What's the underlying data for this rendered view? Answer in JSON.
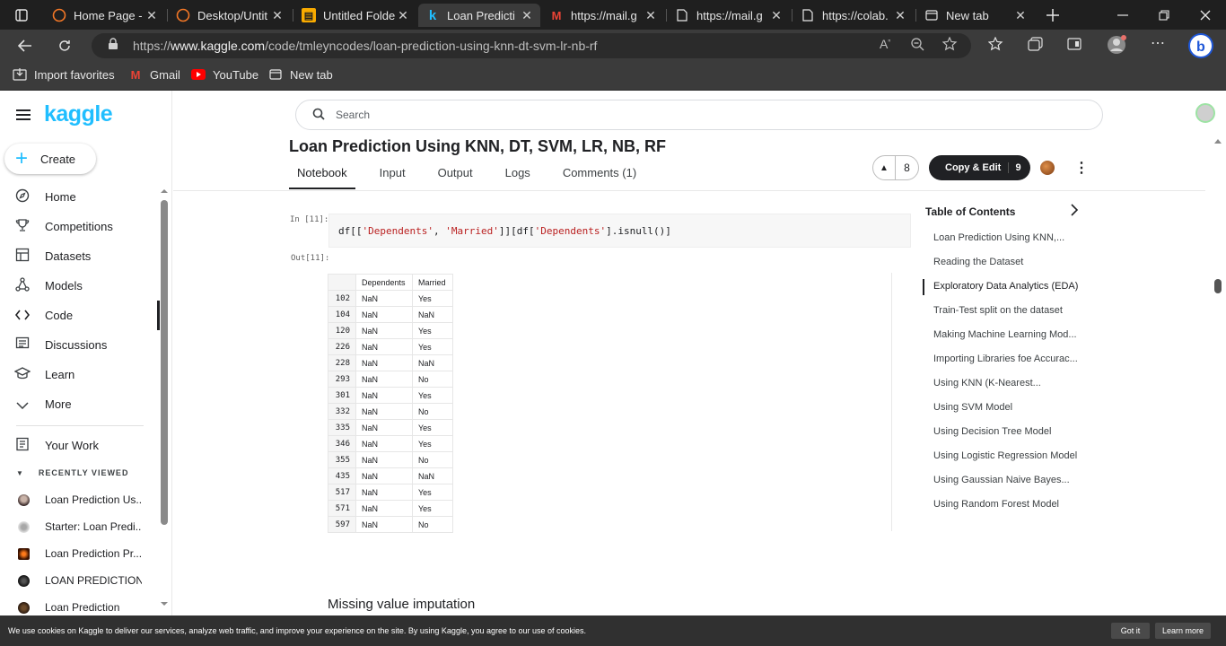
{
  "browser": {
    "tabs": [
      {
        "title": "Home Page -",
        "icon": "jupyter-icon"
      },
      {
        "title": "Desktop/Untit",
        "icon": "jupyter-icon"
      },
      {
        "title": "Untitled Folde",
        "icon": "colab-icon"
      },
      {
        "title": "Loan Predicti",
        "icon": "kaggle-icon",
        "active": true
      },
      {
        "title": "https://mail.g",
        "icon": "gmail-icon"
      },
      {
        "title": "https://mail.g",
        "icon": "page-icon"
      },
      {
        "title": "https://colab.",
        "icon": "page-icon"
      },
      {
        "title": "New tab",
        "icon": "newtab-icon"
      }
    ],
    "url_prefix": "https://",
    "url_domain": "www.kaggle.com",
    "url_path": "/code/tmleyncodes/loan-prediction-using-knn-dt-svm-lr-nb-rf",
    "favorites": {
      "import": "Import favorites",
      "gmail": "Gmail",
      "youtube": "YouTube",
      "newtab": "New tab"
    }
  },
  "sidebar": {
    "logo": "kaggle",
    "create": "Create",
    "items": [
      {
        "label": "Home",
        "icon": "compass-icon"
      },
      {
        "label": "Competitions",
        "icon": "trophy-icon"
      },
      {
        "label": "Datasets",
        "icon": "table-icon"
      },
      {
        "label": "Models",
        "icon": "models-icon"
      },
      {
        "label": "Code",
        "icon": "code-icon",
        "active": true
      },
      {
        "label": "Discussions",
        "icon": "discussions-icon"
      },
      {
        "label": "Learn",
        "icon": "learn-icon"
      },
      {
        "label": "More",
        "icon": "chevron-down-icon"
      }
    ],
    "your_work": "Your Work",
    "recently_viewed": "RECENTLY VIEWED",
    "recent": [
      "Loan Prediction Us...",
      "Starter: Loan Predi...",
      "Loan Prediction Pr...",
      "LOAN PREDICTION...",
      "Loan Prediction"
    ]
  },
  "header": {
    "search_placeholder": "Search",
    "title": "Loan Prediction Using KNN, DT, SVM, LR, NB, RF",
    "tabs": [
      "Notebook",
      "Input",
      "Output",
      "Logs",
      "Comments (1)"
    ],
    "votes": "8",
    "copy_edit": "Copy & Edit",
    "copy_count": "9"
  },
  "notebook": {
    "in_prompt": "In [11]:",
    "out_prompt": "Out[11]:",
    "code": {
      "p1": "df[[",
      "s1": "'Dependents'",
      "p2": ", ",
      "s2": "'Married'",
      "p3": "]][df[",
      "s3": "'Dependents'",
      "p4": "].isnull()]"
    },
    "columns": [
      "Dependents",
      "Married"
    ],
    "rows": [
      [
        "102",
        "NaN",
        "Yes"
      ],
      [
        "104",
        "NaN",
        "NaN"
      ],
      [
        "120",
        "NaN",
        "Yes"
      ],
      [
        "226",
        "NaN",
        "Yes"
      ],
      [
        "228",
        "NaN",
        "NaN"
      ],
      [
        "293",
        "NaN",
        "No"
      ],
      [
        "301",
        "NaN",
        "Yes"
      ],
      [
        "332",
        "NaN",
        "No"
      ],
      [
        "335",
        "NaN",
        "Yes"
      ],
      [
        "346",
        "NaN",
        "Yes"
      ],
      [
        "355",
        "NaN",
        "No"
      ],
      [
        "435",
        "NaN",
        "NaN"
      ],
      [
        "517",
        "NaN",
        "Yes"
      ],
      [
        "571",
        "NaN",
        "Yes"
      ],
      [
        "597",
        "NaN",
        "No"
      ]
    ],
    "next_heading": "Missing value imputation"
  },
  "toc": {
    "title": "Table of Contents",
    "items": [
      "Loan Prediction Using KNN,...",
      "Reading the Dataset",
      "Exploratory Data Analytics (EDA)",
      "Train-Test split on the dataset",
      "Making Machine Learning Mod...",
      "Importing Libraries foe Accurac...",
      "Using KNN (K-Nearest...",
      "Using SVM Model",
      "Using Decision Tree Model",
      "Using Logistic Regression Model",
      "Using Gaussian Naive Bayes...",
      "Using Random Forest Model"
    ],
    "active_index": 2
  },
  "cookie": {
    "text": "We use cookies on Kaggle to deliver our services, analyze web traffic, and improve your experience on the site. By using Kaggle, you agree to our use of cookies.",
    "got_it": "Got it",
    "learn_more": "Learn more"
  }
}
